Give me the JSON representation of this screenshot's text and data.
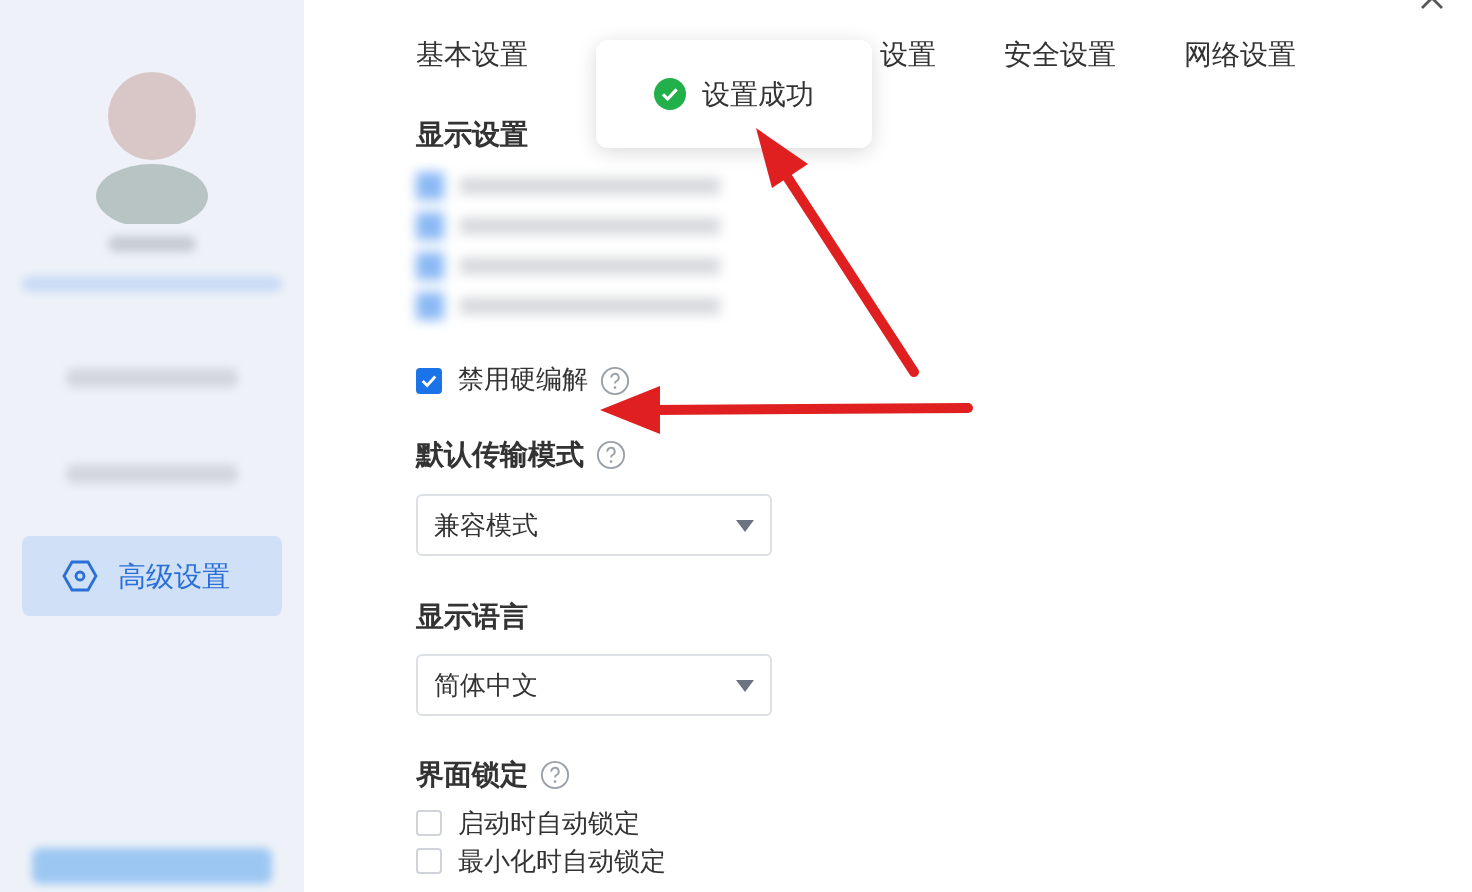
{
  "tabs": [
    {
      "label": "基本设置",
      "selected": false
    },
    {
      "label": "设置",
      "selected": false
    },
    {
      "label": "安全设置",
      "selected": false
    },
    {
      "label": "网络设置",
      "selected": false
    }
  ],
  "toast": {
    "text": "设置成功"
  },
  "sidebar": {
    "items": [
      {
        "label": "高级设置",
        "selected": true
      }
    ]
  },
  "display_settings": {
    "title": "显示设置",
    "options": [
      {
        "label": "禁用硬编解",
        "checked": true
      }
    ]
  },
  "transfer_mode": {
    "title": "默认传输模式",
    "value": "兼容模式"
  },
  "language": {
    "title": "显示语言",
    "value": "简体中文"
  },
  "lock": {
    "title": "界面锁定",
    "options": [
      {
        "label": "启动时自动锁定",
        "checked": false
      },
      {
        "label": "最小化时自动锁定",
        "checked": false
      }
    ]
  }
}
